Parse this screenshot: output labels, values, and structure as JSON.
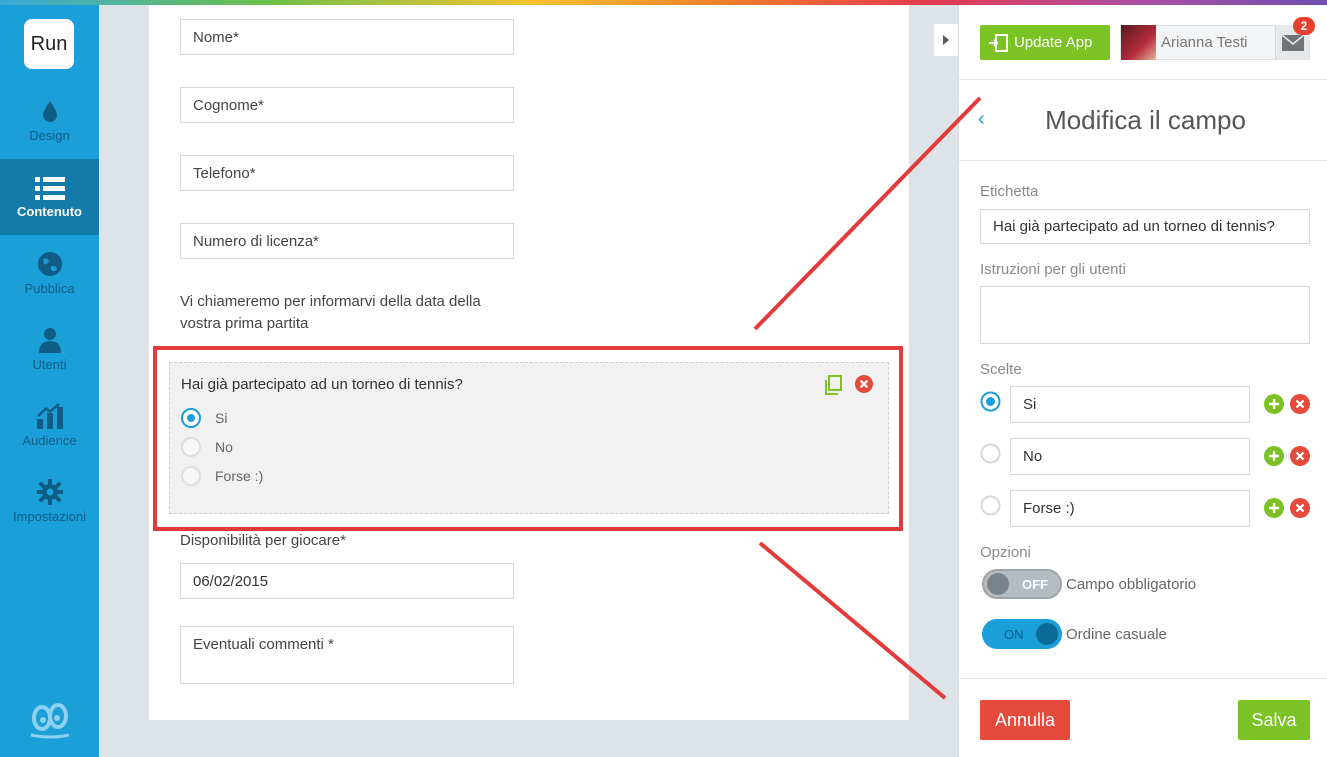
{
  "app": {
    "logo_text": "Run"
  },
  "sidebar": {
    "items": [
      {
        "label": "Design",
        "icon": "drop-icon"
      },
      {
        "label": "Contenuto",
        "icon": "list-icon",
        "active": true
      },
      {
        "label": "Pubblica",
        "icon": "globe-icon"
      },
      {
        "label": "Utenti",
        "icon": "user-icon"
      },
      {
        "label": "Audience",
        "icon": "bar-chart-icon"
      },
      {
        "label": "Impostazioni",
        "icon": "gear-icon"
      }
    ]
  },
  "form": {
    "fields": [
      "Nome*",
      "Cognome*",
      "Telefono*",
      "Numero di licenza*"
    ],
    "info_text": "Vi chiameremo per informarvi della data della vostra prima partita",
    "selected_question": {
      "label": "Hai già partecipato ad un torneo di tennis?",
      "options": [
        "Si",
        "No",
        "Forse :)"
      ],
      "checked": "Si"
    },
    "availability_label": "Disponibilità per giocare*",
    "availability_value": "06/02/2015",
    "comments_placeholder": "Eventuali commenti *"
  },
  "header": {
    "update_button": "Update App",
    "user_name": "Arianna Testi",
    "mail_badge": "2"
  },
  "panel": {
    "title": "Modifica il campo",
    "back": "‹",
    "label_heading": "Etichetta",
    "label_value": "Hai già partecipato ad un torneo di tennis?",
    "instructions_heading": "Istruzioni per gli utenti",
    "instructions_value": "",
    "choices_heading": "Scelte",
    "choices": [
      "Si",
      "No",
      "Forse :)"
    ],
    "options_heading": "Opzioni",
    "toggle_required": {
      "state": "OFF",
      "label": "Campo obbligatorio"
    },
    "toggle_random": {
      "state": "ON",
      "label": "Ordine casuale"
    },
    "cancel": "Annulla",
    "save": "Salva"
  },
  "colors": {
    "accent": "#1b9fd9",
    "green": "#7bc224",
    "red": "#e33b3b"
  }
}
